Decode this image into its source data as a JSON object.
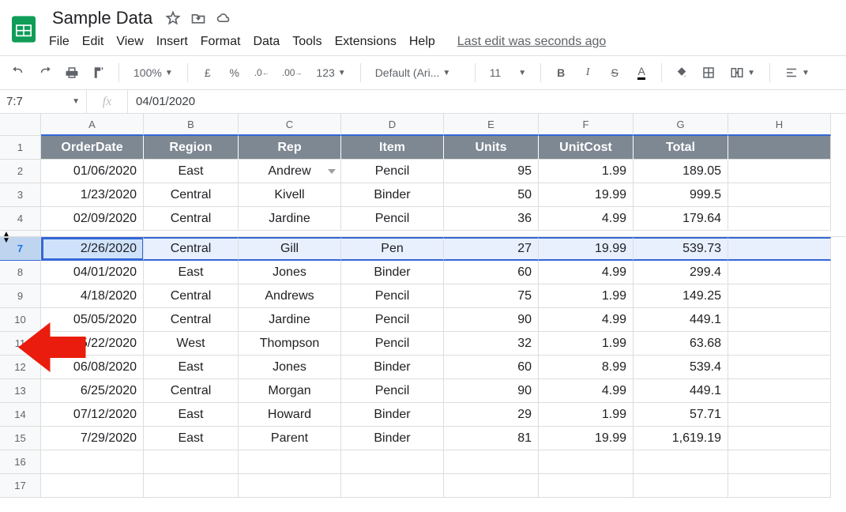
{
  "doc": {
    "title": "Sample Data"
  },
  "menu": {
    "file": "File",
    "edit": "Edit",
    "view": "View",
    "insert": "Insert",
    "format": "Format",
    "data": "Data",
    "tools": "Tools",
    "extensions": "Extensions",
    "help": "Help",
    "last_edit": "Last edit was seconds ago"
  },
  "toolbar": {
    "zoom": "100%",
    "currency": "£",
    "percent": "%",
    "dec_dec": ".0",
    "dec_inc": ".00",
    "numfmt": "123",
    "font": "Default (Ari...",
    "size": "11",
    "bold": "B",
    "italic": "I",
    "strike": "S",
    "textcolor": "A"
  },
  "fx": {
    "namebox": "7:7",
    "formula": "04/01/2020"
  },
  "columns": [
    "A",
    "B",
    "C",
    "D",
    "E",
    "F",
    "G",
    "H"
  ],
  "headers": [
    "OrderDate",
    "Region",
    "Rep",
    "Item",
    "Units",
    "UnitCost",
    "Total",
    ""
  ],
  "row_labels": [
    "1",
    "2",
    "3",
    "4",
    "",
    "7",
    "8",
    "9",
    "10",
    "11",
    "12",
    "13",
    "14",
    "15",
    "16",
    "17"
  ],
  "selected_row_label": "7",
  "rows": [
    {
      "date": "01/06/2020",
      "region": "East",
      "rep": "Andrew",
      "item": "Pencil",
      "units": "95",
      "cost": "1.99",
      "total": "189.05"
    },
    {
      "date": "1/23/2020",
      "region": "Central",
      "rep": "Kivell",
      "item": "Binder",
      "units": "50",
      "cost": "19.99",
      "total": "999.5"
    },
    {
      "date": "02/09/2020",
      "region": "Central",
      "rep": "Jardine",
      "item": "Pencil",
      "units": "36",
      "cost": "4.99",
      "total": "179.64"
    },
    {
      "date": "2/26/2020",
      "region": "Central",
      "rep": "Gill",
      "item": "Pen",
      "units": "27",
      "cost": "19.99",
      "total": "539.73"
    },
    {
      "date": "04/01/2020",
      "region": "East",
      "rep": "Jones",
      "item": "Binder",
      "units": "60",
      "cost": "4.99",
      "total": "299.4"
    },
    {
      "date": "4/18/2020",
      "region": "Central",
      "rep": "Andrews",
      "item": "Pencil",
      "units": "75",
      "cost": "1.99",
      "total": "149.25"
    },
    {
      "date": "05/05/2020",
      "region": "Central",
      "rep": "Jardine",
      "item": "Pencil",
      "units": "90",
      "cost": "4.99",
      "total": "449.1"
    },
    {
      "date": "5/22/2020",
      "region": "West",
      "rep": "Thompson",
      "item": "Pencil",
      "units": "32",
      "cost": "1.99",
      "total": "63.68"
    },
    {
      "date": "06/08/2020",
      "region": "East",
      "rep": "Jones",
      "item": "Binder",
      "units": "60",
      "cost": "8.99",
      "total": "539.4"
    },
    {
      "date": "6/25/2020",
      "region": "Central",
      "rep": "Morgan",
      "item": "Pencil",
      "units": "90",
      "cost": "4.99",
      "total": "449.1"
    },
    {
      "date": "07/12/2020",
      "region": "East",
      "rep": "Howard",
      "item": "Binder",
      "units": "29",
      "cost": "1.99",
      "total": "57.71"
    },
    {
      "date": "7/29/2020",
      "region": "East",
      "rep": "Parent",
      "item": "Binder",
      "units": "81",
      "cost": "19.99",
      "total": "1,619.19"
    }
  ]
}
